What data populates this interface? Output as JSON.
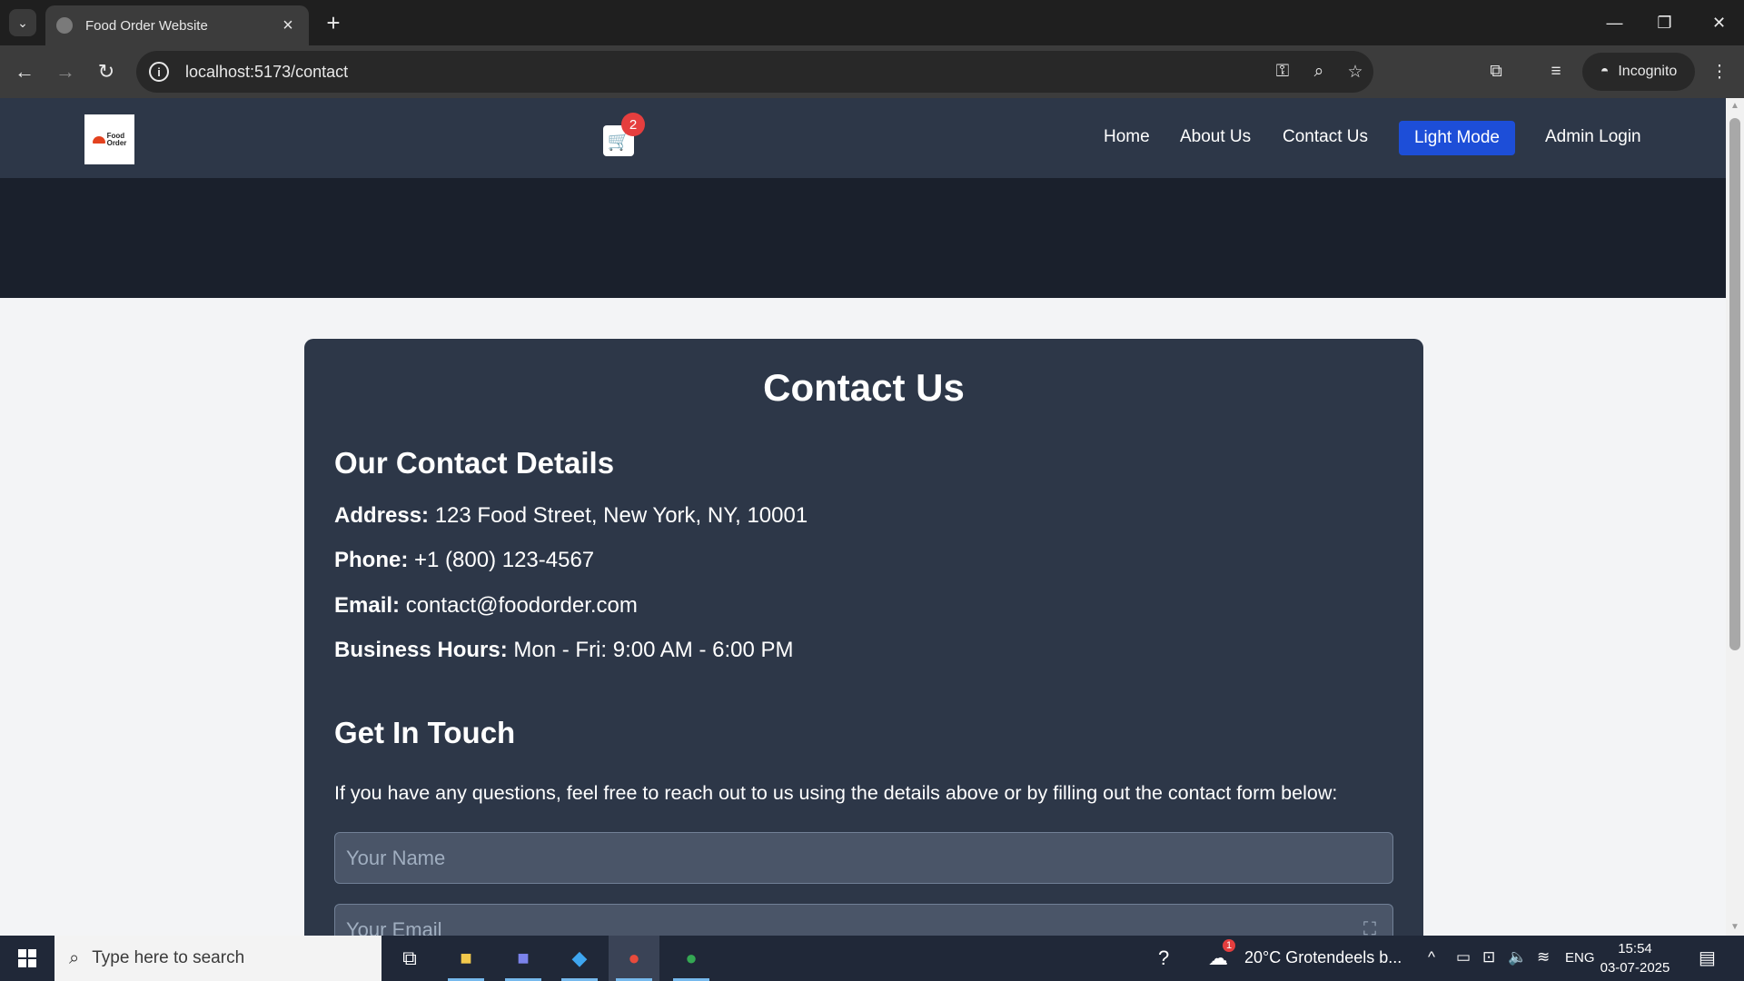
{
  "browser": {
    "tab_title": "Food Order Website",
    "url": "localhost:5173/contact",
    "incognito_label": "Incognito"
  },
  "site": {
    "logo_text_line1": "Food",
    "logo_text_line2": "Order",
    "cart_count": "2",
    "nav_links": [
      "Home",
      "About Us",
      "Contact Us"
    ],
    "mode_button": "Light Mode",
    "admin_link": "Admin Login"
  },
  "contact": {
    "title": "Contact Us",
    "details_heading": "Our Contact Details",
    "address_label": "Address:",
    "address_value": "123 Food Street, New York, NY, 10001",
    "phone_label": "Phone:",
    "phone_value": "+1 (800) 123-4567",
    "email_label": "Email:",
    "email_value": "contact@foodorder.com",
    "hours_label": "Business Hours:",
    "hours_value": "Mon - Fri: 9:00 AM - 6:00 PM",
    "touch_heading": "Get In Touch",
    "intro": "If you have any questions, feel free to reach out to us using the details above or by filling out the contact form below:",
    "name_placeholder": "Your Name",
    "email_placeholder": "Your Email"
  },
  "taskbar": {
    "search_placeholder": "Type here to search",
    "weather": "20°C  Grotendeels b...",
    "weather_alert": "1",
    "language": "ENG",
    "time": "15:54",
    "date": "03-07-2025"
  },
  "colors": {
    "nav_bg": "#2d3748",
    "hero_bg": "#1a202c",
    "card_bg": "#2d3748",
    "accent_button": "#1d4ed8",
    "badge": "#e53e3e"
  }
}
